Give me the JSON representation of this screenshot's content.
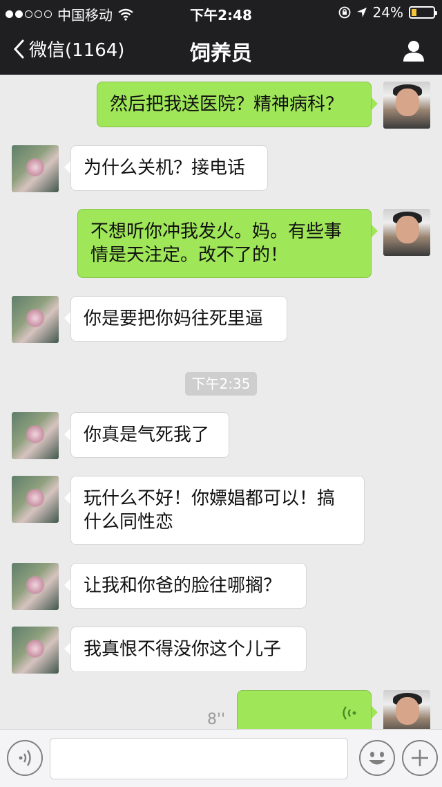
{
  "status_bar": {
    "carrier": "中国移动",
    "time": "下午2:48",
    "battery": "24%",
    "battery_fraction": 0.24
  },
  "nav": {
    "back_label": "微信(1164)",
    "title": "饲养员"
  },
  "messages": [
    {
      "side": "out",
      "text": "然后把我送医院？精神病科？"
    },
    {
      "side": "in",
      "text": "为什么关机？接电话"
    },
    {
      "side": "out",
      "text": "不想听你冲我发火。妈。有些事情是天注定。改不了的！"
    },
    {
      "side": "in",
      "text": "你是要把你妈往死里逼"
    },
    {
      "side": "in",
      "text": "你真是气死我了"
    },
    {
      "side": "in",
      "text": "玩什么不好！你嫖娼都可以！搞什么同性恋"
    },
    {
      "side": "in",
      "text": "让我和你爸的脸往哪搁？"
    },
    {
      "side": "in",
      "text": "我真恨不得没你这个儿子"
    }
  ],
  "timestamp": "下午2:35",
  "voice_message": {
    "duration": "8''"
  },
  "icons": {
    "back": "chevron-left-icon",
    "contact": "person-icon",
    "voice_mode": "voice-mode-icon",
    "emoji": "emoji-icon",
    "add": "plus-icon"
  },
  "colors": {
    "nav_bg": "#1f1f22",
    "chat_bg": "#ebebeb",
    "out_bubble": "#9fe658",
    "in_bubble": "#ffffff"
  }
}
